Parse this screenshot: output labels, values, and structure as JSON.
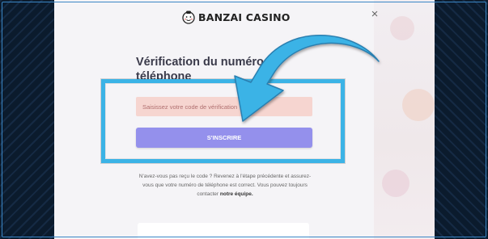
{
  "logo": {
    "text": "BANZAI CASINO",
    "icon": "sumo-wrestler-icon"
  },
  "close_icon": "×",
  "title": "Vérification du numéro de téléphone",
  "code_input": {
    "placeholder": "Saisissez votre code de vérification"
  },
  "submit_label": "S'INSCRIRE",
  "help": {
    "text": "N'avez-vous pas reçu le code ? Revenez à l'étape précédente et assurez-vous que votre numéro de téléphone est correct. Vous pouvez toujours contacter",
    "link": "notre équipe."
  },
  "colors": {
    "accent_button": "#9490ec",
    "input_bg": "#f6d5d0",
    "highlight": "#3bb3e6",
    "page_bg": "#0b1b2d"
  }
}
